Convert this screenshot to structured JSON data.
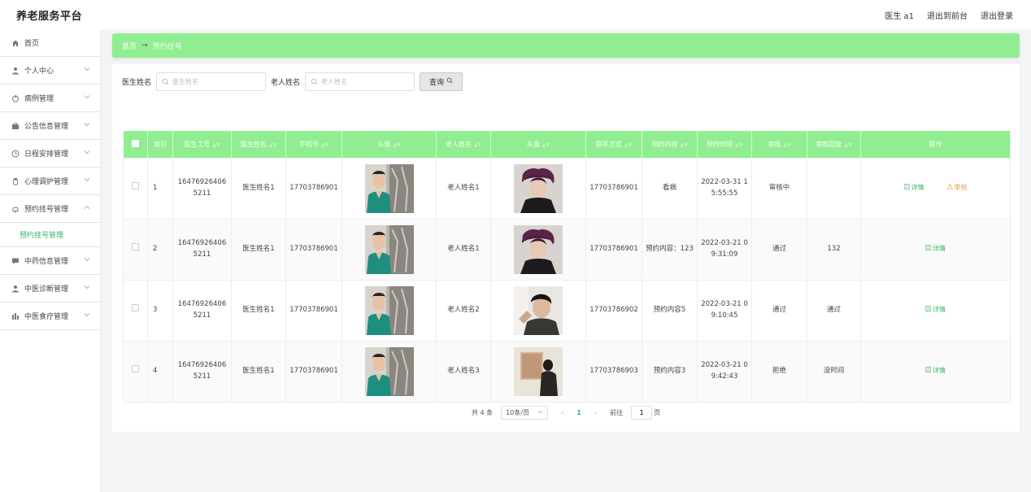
{
  "header": {
    "brand": "养老服务平台",
    "user": "医生 a1",
    "front": "退出到前台",
    "logout": "退出登录"
  },
  "sidebar": {
    "items": [
      {
        "label": "首页",
        "icon": "home-icon",
        "arrow": false
      },
      {
        "label": "个人中心",
        "icon": "user-icon",
        "arrow": true
      },
      {
        "label": "病例管理",
        "icon": "power-icon",
        "arrow": true
      },
      {
        "label": "公告信息管理",
        "icon": "briefcase-icon",
        "arrow": true
      },
      {
        "label": "日程安排管理",
        "icon": "clock-icon",
        "arrow": true
      },
      {
        "label": "心理调护管理",
        "icon": "bottle-icon",
        "arrow": true
      },
      {
        "label": "预约挂号管理",
        "icon": "bell-icon",
        "arrow": true,
        "expanded": true,
        "sub": "预约挂号管理"
      },
      {
        "label": "中药信息管理",
        "icon": "chat-icon",
        "arrow": true
      },
      {
        "label": "中医诊断管理",
        "icon": "user-icon",
        "arrow": true
      },
      {
        "label": "中医食疗管理",
        "icon": "chart-icon",
        "arrow": true
      }
    ]
  },
  "breadcrumb": {
    "home": "首页",
    "sep": "→",
    "current": "预约挂号"
  },
  "search": {
    "doctor_label": "医生姓名",
    "doctor_placeholder": "医生姓名",
    "elder_label": "老人姓名",
    "elder_placeholder": "老人姓名",
    "query_label": "查询"
  },
  "table": {
    "headers": [
      "索引",
      "医生工号",
      "医生姓名",
      "手机号",
      "头像",
      "老人姓名",
      "头像",
      "联系方式",
      "预约内容",
      "预约时间",
      "审核",
      "审核回复",
      "操作"
    ],
    "rows": [
      {
        "index": "1",
        "doctor_id": "164769264065211",
        "doctor_name": "医生姓名1",
        "phone": "17703786901",
        "elder_name": "老人姓名1",
        "contact": "17703786901",
        "content": "看病",
        "time": "2022-03-31 15:55:55",
        "audit": "审核中",
        "reply": "",
        "ops": [
          "详情",
          "审核"
        ]
      },
      {
        "index": "2",
        "doctor_id": "164769264065211",
        "doctor_name": "医生姓名1",
        "phone": "17703786901",
        "elder_name": "老人姓名1",
        "contact": "17703786901",
        "content": "预约内容：123",
        "time": "2022-03-21 09:31:09",
        "audit": "通过",
        "reply": "132",
        "ops": [
          "详情"
        ]
      },
      {
        "index": "3",
        "doctor_id": "164769264065211",
        "doctor_name": "医生姓名1",
        "phone": "17703786901",
        "elder_name": "老人姓名2",
        "contact": "17703786902",
        "content": "预约内容5",
        "time": "2022-03-21 09:10:45",
        "audit": "通过",
        "reply": "通过",
        "ops": [
          "详情"
        ]
      },
      {
        "index": "4",
        "doctor_id": "164769264065211",
        "doctor_name": "医生姓名1",
        "phone": "17703786901",
        "elder_name": "老人姓名3",
        "contact": "17703786903",
        "content": "预约内容3",
        "time": "2022-03-21 09:42:43",
        "audit": "拒绝",
        "reply": "没时间",
        "ops": [
          "详情"
        ]
      }
    ]
  },
  "pager": {
    "total": "共 4 条",
    "size": "10条/页",
    "page": "1",
    "goto_prefix": "前往",
    "goto_value": "1",
    "goto_suffix": "页"
  },
  "colors": {
    "accent": "#90ee90",
    "link": "#38b36a",
    "warn": "#e6a23c"
  }
}
